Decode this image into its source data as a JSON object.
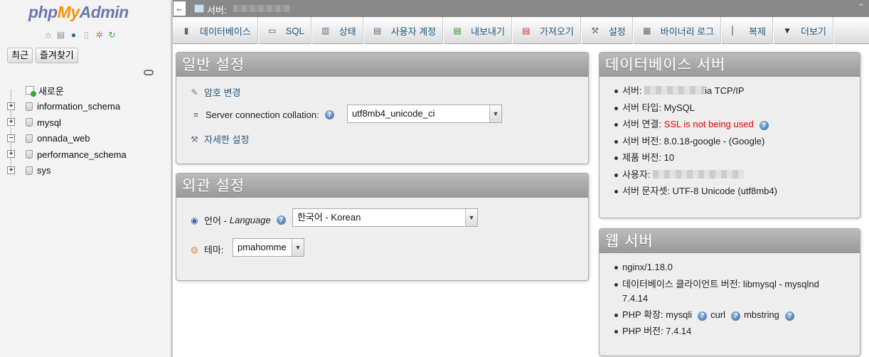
{
  "nav": {
    "logo": {
      "php": "php",
      "my": "My",
      "admin": "Admin"
    },
    "icons": [
      "home-icon",
      "exit-icon",
      "help-icon",
      "docs-icon",
      "gear-icon",
      "reload-icon"
    ],
    "recent_label": "최근",
    "favorites_label": "즐겨찾기",
    "tree": [
      {
        "label": "새로운",
        "type": "new"
      },
      {
        "label": "information_schema",
        "type": "db",
        "expander": "+"
      },
      {
        "label": "mysql",
        "type": "db",
        "expander": "+"
      },
      {
        "label": "onnada_web",
        "type": "db",
        "expander": "−"
      },
      {
        "label": "performance_schema",
        "type": "db",
        "expander": "+"
      },
      {
        "label": "sys",
        "type": "db",
        "expander": "+"
      }
    ]
  },
  "topbar": {
    "back": "←",
    "server_label": "서버:",
    "collapse": "⌃"
  },
  "tabs": [
    {
      "label": "데이터베이스",
      "icon": "database-icon"
    },
    {
      "label": "SQL",
      "icon": "sql-icon"
    },
    {
      "label": "상태",
      "icon": "status-icon"
    },
    {
      "label": "사용자 계정",
      "icon": "users-icon"
    },
    {
      "label": "내보내기",
      "icon": "export-icon"
    },
    {
      "label": "가져오기",
      "icon": "import-icon"
    },
    {
      "label": "설정",
      "icon": "wrench-icon"
    },
    {
      "label": "바이너리 로그",
      "icon": "binlog-icon"
    },
    {
      "label": "복제",
      "icon": "replication-icon"
    },
    {
      "label": "더보기",
      "icon": "caret-down-icon"
    }
  ],
  "general": {
    "title": "일반 설정",
    "change_password": "암호 변경",
    "collation_label": "Server connection collation:",
    "collation_value": "utf8mb4_unicode_ci",
    "more_settings": "자세한 설정"
  },
  "appearance": {
    "title": "외관 설정",
    "language_label": "언어 - ",
    "language_label_italic": "Language",
    "language_value": "한국어 - Korean",
    "theme_label": "테마:",
    "theme_value": "pmahomme"
  },
  "db_server": {
    "title": "데이터베이스 서버",
    "server_label": "서버:",
    "server_suffix": "ia TCP/IP",
    "type": "서버 타입: MySQL",
    "connection_label": "서버 연결: ",
    "connection_value": "SSL is not being used",
    "version": "서버 버전: 8.0.18-google - (Google)",
    "protocol": "제품 버전: 10",
    "user_label": "사용자:",
    "charset": "서버 문자셋: UTF-8 Unicode (utf8mb4)"
  },
  "web_server": {
    "title": "웹 서버",
    "nginx": "nginx/1.18.0",
    "client_line1": "데이터베이스 클라이언트 버전: libmysql - mysqlnd",
    "client_line2": "7.4.14",
    "php_ext_label": "PHP 확장: ",
    "ext1": "mysqli",
    "ext2": "curl",
    "ext3": "mbstring",
    "php_version": "PHP 버전: 7.4.14"
  }
}
